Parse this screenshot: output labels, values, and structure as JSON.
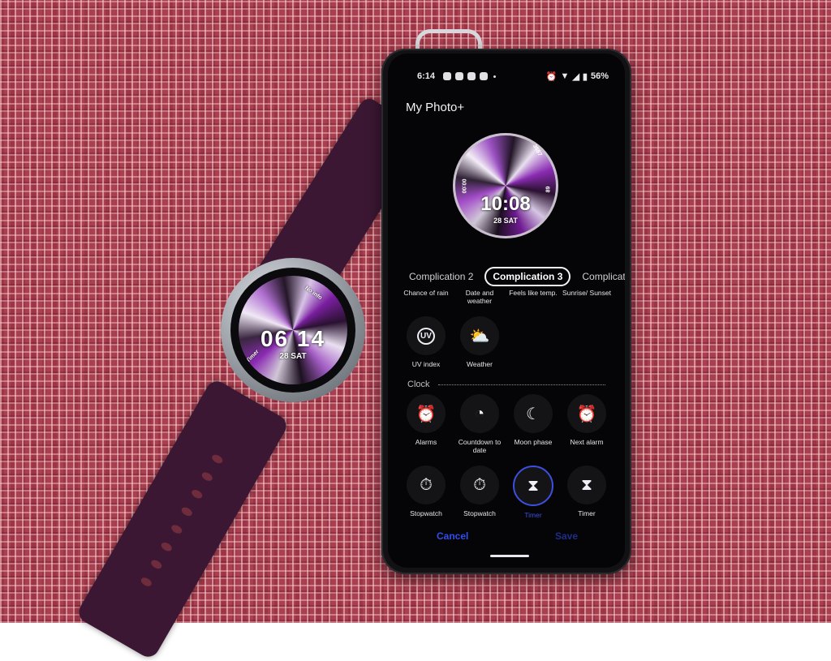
{
  "scene": {
    "description": "Photo of a smartwatch and an Android phone on a red woven placemat",
    "colors": {
      "placemat": "#a8404f",
      "strap": "#3b1733",
      "accent_blue": "#2f4ef0"
    }
  },
  "watch": {
    "time_hour": "06",
    "time_minute": "14",
    "date": "28 SAT",
    "complication_top": "No info",
    "complication_left": "Timer"
  },
  "phone": {
    "status_bar": {
      "time": "6:14",
      "notification_icons": [
        "instagram-icon",
        "reddit-icon",
        "app-icon",
        "pocket-icon"
      ],
      "right_icons": [
        "alarm-icon",
        "wifi-icon",
        "signal-icon",
        "battery-icon"
      ],
      "battery": "56%"
    },
    "title": "My Photo+",
    "preview": {
      "time": "10:08",
      "date": "28 SAT",
      "complication_top_right": "3587",
      "complication_left": "00:00",
      "complication_right": "89"
    },
    "tabs": [
      {
        "label": "Complication 2",
        "active": false
      },
      {
        "label": "Complication 3",
        "active": true
      },
      {
        "label": "Complicat",
        "active": false
      }
    ],
    "weather_labels": [
      "Chance of rain",
      "Date and weather",
      "Feels like temp.",
      "Sunrise/ Sunset"
    ],
    "weather_items": [
      {
        "label": "UV index",
        "icon": "uv-index-icon",
        "glyph": "UV"
      },
      {
        "label": "Weather",
        "icon": "weather-icon",
        "glyph": "⛅"
      }
    ],
    "section_clock": "Clock",
    "clock_items": [
      {
        "label": "Alarms",
        "icon": "alarm-clock-icon",
        "glyph": "⏰"
      },
      {
        "label": "Countdown to date",
        "icon": "countdown-icon",
        "glyph": "◔"
      },
      {
        "label": "Moon phase",
        "icon": "moon-icon",
        "glyph": "☾"
      },
      {
        "label": "Next alarm",
        "icon": "next-alarm-icon",
        "glyph": "⏰"
      }
    ],
    "timer_items": [
      {
        "label": "Stopwatch",
        "icon": "stopwatch-filled-icon",
        "glyph": "⏱",
        "selected": false
      },
      {
        "label": "Stopwatch",
        "icon": "stopwatch-outline-icon",
        "glyph": "⏱",
        "selected": false
      },
      {
        "label": "Timer",
        "icon": "hourglass-icon",
        "glyph": "⧗",
        "selected": true
      },
      {
        "label": "Timer",
        "icon": "hourglass-filled-icon",
        "glyph": "⧗",
        "selected": false
      }
    ],
    "cancel_label": "Cancel",
    "save_label": "Save"
  }
}
